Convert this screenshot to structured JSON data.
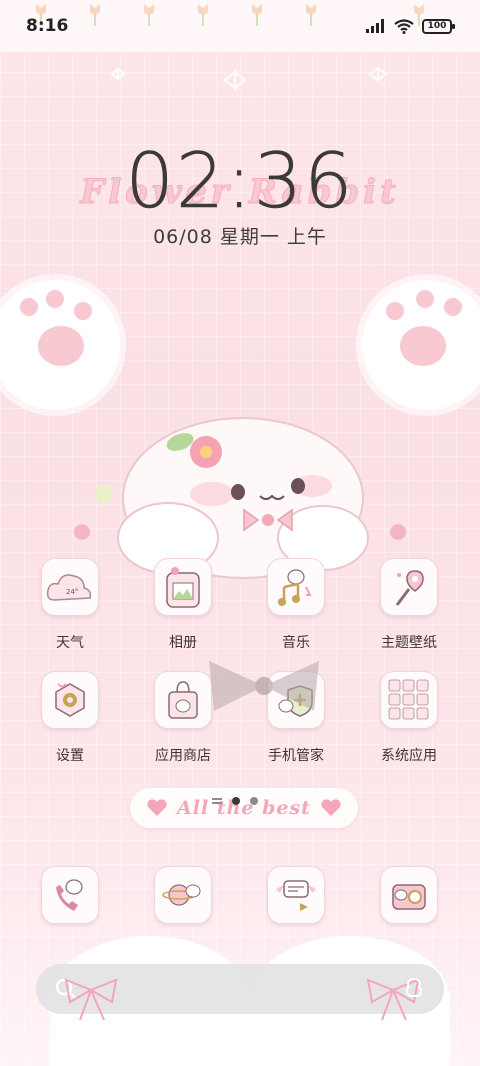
{
  "status_bar": {
    "time": "8:16",
    "battery": "100"
  },
  "lockscreen": {
    "clock": "02:36",
    "watermark": "Flower Rabbit",
    "date": "06/08 星期一 上午"
  },
  "apps": [
    {
      "label": "天气",
      "icon": "weather-cloud-icon",
      "temp": "24°"
    },
    {
      "label": "相册",
      "icon": "gallery-icon"
    },
    {
      "label": "音乐",
      "icon": "music-icon"
    },
    {
      "label": "主题壁纸",
      "icon": "theme-wand-icon"
    },
    {
      "label": "设置",
      "icon": "settings-icon"
    },
    {
      "label": "应用商店",
      "icon": "app-store-bag-icon"
    },
    {
      "label": "手机管家",
      "icon": "phone-manager-shield-icon"
    },
    {
      "label": "系统应用",
      "icon": "system-apps-folder-icon"
    }
  ],
  "banner": {
    "text": "All the best"
  },
  "page_indicator": {
    "pages": 2,
    "active": 1
  },
  "dock": [
    {
      "icon": "phone-icon"
    },
    {
      "icon": "browser-planet-icon"
    },
    {
      "icon": "messages-icon"
    },
    {
      "icon": "camera-icon"
    }
  ],
  "colors": {
    "background": "#fbe3e6",
    "accent_pink": "#f3a6b7",
    "text": "#3f3336"
  }
}
